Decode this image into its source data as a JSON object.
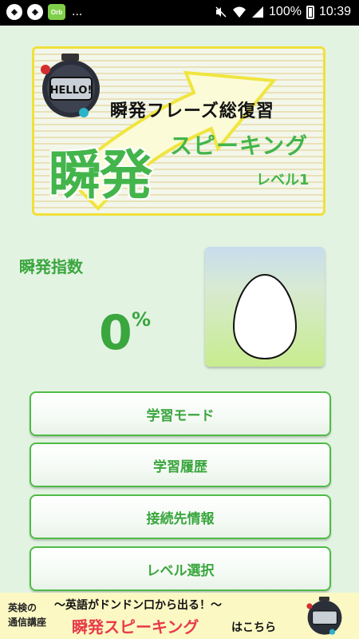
{
  "status_bar": {
    "notification_overflow": "...",
    "battery_percent": "100%",
    "time": "10:39",
    "app_icon_label": "Orb"
  },
  "banner": {
    "subtitle": "瞬発フレーズ総復習",
    "title_main": "瞬発",
    "title_speaking": "スピーキング",
    "level": "レベル1",
    "stopwatch_text": "HELLO!"
  },
  "index": {
    "label": "瞬発指数",
    "value": "0",
    "unit": "%"
  },
  "menu": [
    {
      "label": "学習モード"
    },
    {
      "label": "学習履歴"
    },
    {
      "label": "接続先情報"
    },
    {
      "label": "レベル選択"
    }
  ],
  "ad": {
    "left_line1": "英検の",
    "left_line2": "通信講座",
    "catch": "〜英語がドンドン口から出る！〜",
    "brand": "瞬発スピーキング",
    "cta": "はこちら"
  },
  "colors": {
    "accent": "#3aa63e",
    "background": "#e3f3e2",
    "banner_border": "#f1e03a",
    "ad_brand": "#e83a49"
  }
}
